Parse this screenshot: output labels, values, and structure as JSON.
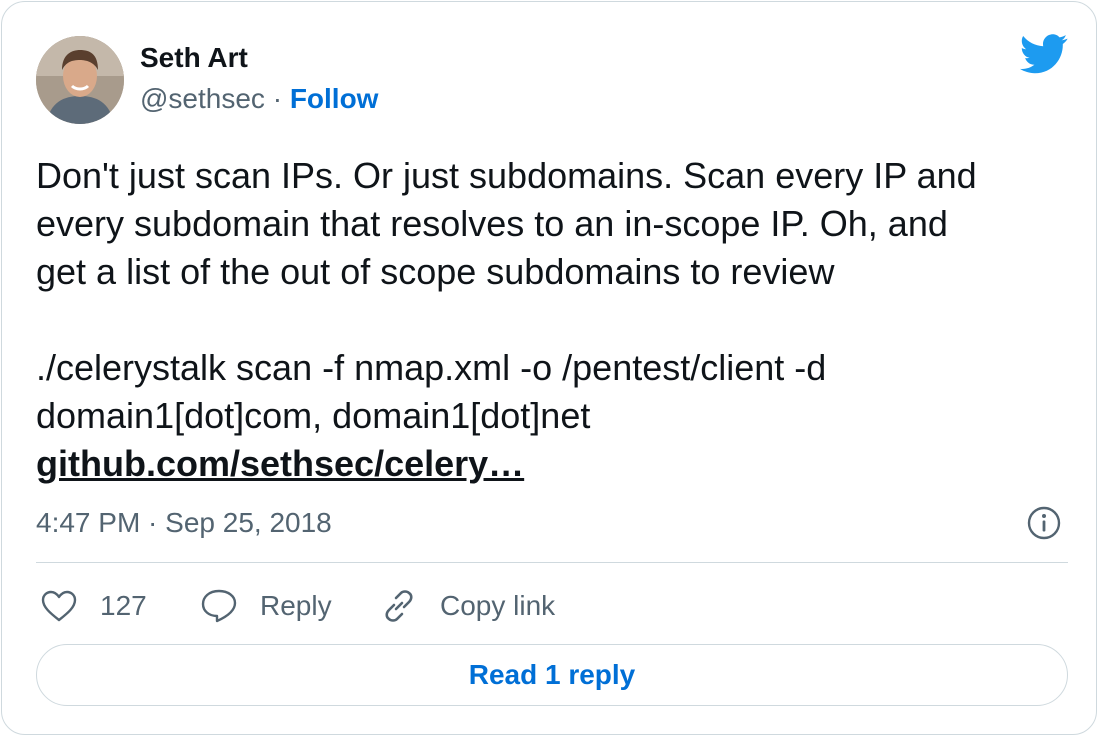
{
  "author": {
    "name": "Seth Art",
    "handle": "@sethsec",
    "separator": " · ",
    "follow_label": "Follow"
  },
  "tweet": {
    "lines": [
      "Don't just scan IPs. Or just subdomains. Scan every IP and",
      "every subdomain that resolves to an in-scope IP. Oh, and",
      "get a list of the out of scope subdomains to review",
      "",
      "./celerystalk scan -f nmap.xml -o /pentest/client -d",
      "domain1[dot]com, domain1[dot]net"
    ],
    "link_text": "github.com/sethsec/celery…"
  },
  "meta": {
    "timestamp": "4:47 PM · Sep 25, 2018"
  },
  "actions": {
    "like_count": "127",
    "reply_label": "Reply",
    "copy_link_label": "Copy link"
  },
  "read_reply_label": "Read 1 reply",
  "colors": {
    "brand_blue": "#1d9bf0",
    "link_blue": "#006fd6",
    "text_primary": "#0f1419",
    "text_secondary": "#536471",
    "border": "#cfd9de"
  },
  "icons": {
    "brand": "twitter-bird-icon",
    "info": "info-icon",
    "like": "heart-icon",
    "reply": "speech-bubble-icon",
    "copy_link": "link-icon"
  }
}
